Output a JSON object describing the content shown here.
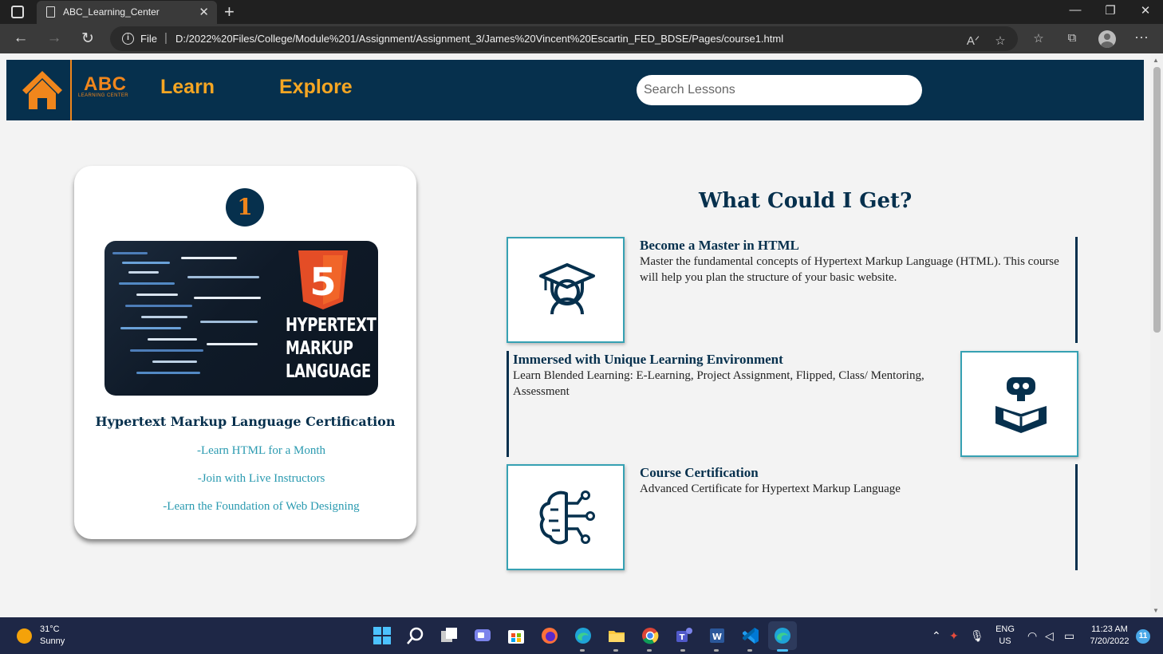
{
  "browser": {
    "tab_title": "ABC_Learning_Center",
    "file_label": "File",
    "url": "D:/2022%20Files/College/Module%201/Assignment/Assignment_3/James%20Vincent%20Escartin_FED_BDSE/Pages/course1.html"
  },
  "site": {
    "logo_text": "ABC",
    "logo_subtext": "LEARNING CENTER",
    "nav": [
      "Learn",
      "Explore"
    ],
    "search_placeholder": "Search Lessons",
    "colors": {
      "header_bg": "#06304d",
      "accent_orange": "#f0861c",
      "link_teal": "#2a9ab0"
    }
  },
  "course_card": {
    "number": "1",
    "image_lines": [
      "HYPERTEXT",
      "MARKUP",
      "LANGUAGE"
    ],
    "image_badge": "5",
    "title": "Hypertext Markup Language Certification",
    "bullets": [
      "-Learn HTML for a Month",
      "-Join with Live Instructors",
      "-Learn the Foundation of Web Designing"
    ]
  },
  "benefits": {
    "title": "What Could I Get?",
    "items": [
      {
        "title": "Become a Master in HTML",
        "description": "Master the fundamental concepts of Hypertext Markup Language (HTML). This course will help you plan the structure of your basic website.",
        "icon": "graduate-icon"
      },
      {
        "title": "Immersed with Unique Learning Environment",
        "description": "Learn Blended Learning: E-Learning, Project Assignment, Flipped, Class/ Mentoring, Assessment",
        "icon": "robot-book-icon"
      },
      {
        "title": "Course Certification",
        "description": "Advanced Certificate for Hypertext Markup Language",
        "icon": "brain-circuit-icon"
      }
    ]
  },
  "taskbar": {
    "weather_temp": "31°C",
    "weather_condition": "Sunny",
    "language": "ENG",
    "region": "US",
    "time": "11:23 AM",
    "date": "7/20/2022",
    "notification_count": "11"
  }
}
